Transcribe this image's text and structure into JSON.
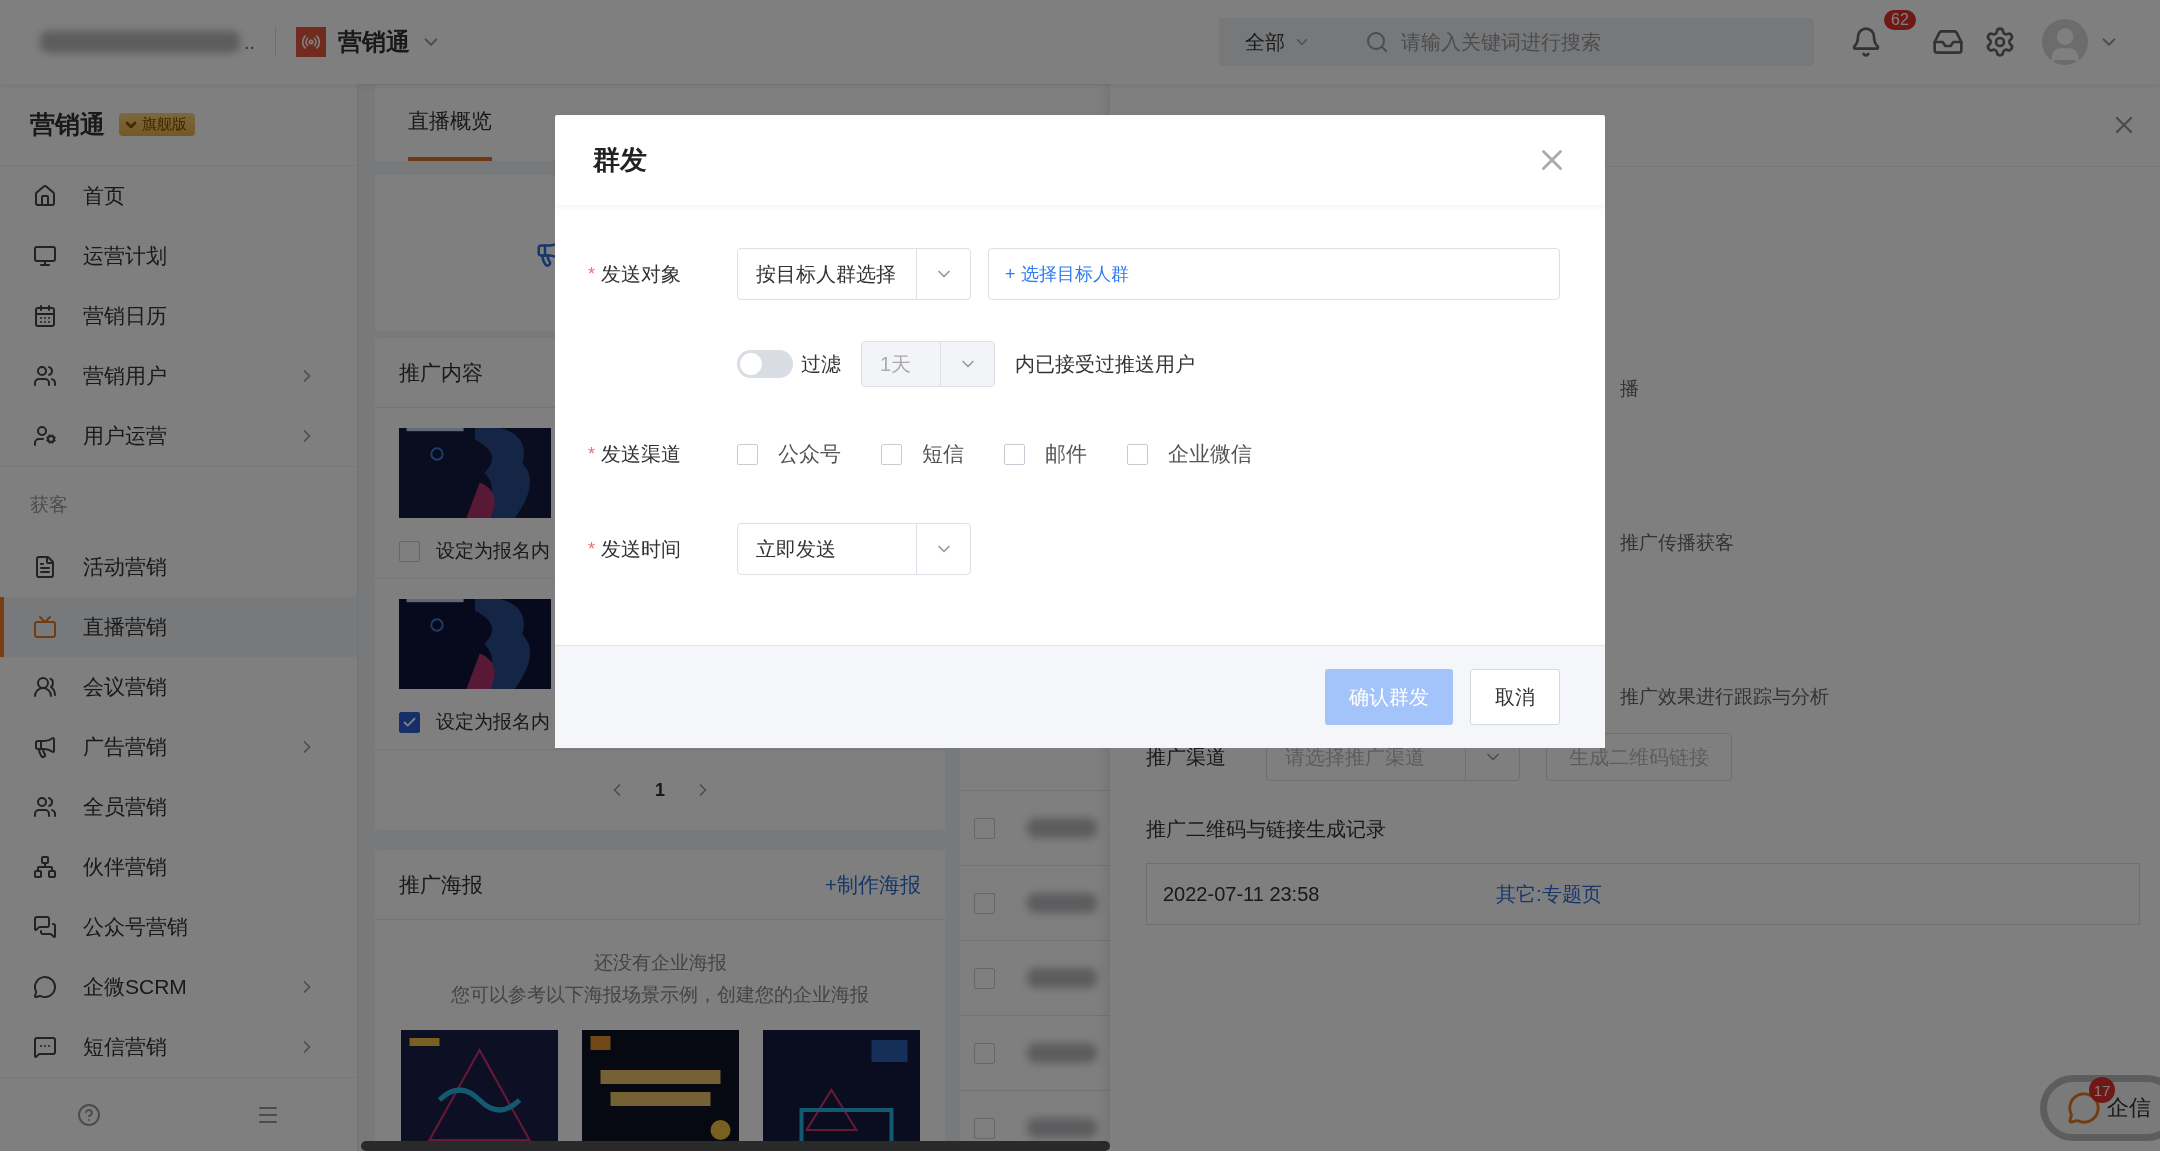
{
  "topbar": {
    "org_name_tail": "..",
    "app_name": "营销通",
    "search_scope": "全部",
    "search_placeholder": "请输入关键词进行搜索",
    "notification_count": "62"
  },
  "sidebar": {
    "brand": "营销通",
    "edition": "旗舰版",
    "groups": [
      {
        "items": [
          {
            "label": "首页",
            "selected": false,
            "expandable": false
          },
          {
            "label": "运营计划",
            "selected": false,
            "expandable": false
          },
          {
            "label": "营销日历",
            "selected": false,
            "expandable": false
          },
          {
            "label": "营销用户",
            "selected": false,
            "expandable": true
          },
          {
            "label": "用户运营",
            "selected": false,
            "expandable": true
          }
        ]
      },
      {
        "title": "获客",
        "items": [
          {
            "label": "活动营销",
            "selected": false,
            "expandable": false
          },
          {
            "label": "直播营销",
            "selected": true,
            "expandable": false
          },
          {
            "label": "会议营销",
            "selected": false,
            "expandable": false
          },
          {
            "label": "广告营销",
            "selected": false,
            "expandable": true
          },
          {
            "label": "全员营销",
            "selected": false,
            "expandable": false
          },
          {
            "label": "伙伴营销",
            "selected": false,
            "expandable": false
          },
          {
            "label": "公众号营销",
            "selected": false,
            "expandable": false
          },
          {
            "label": "企微SCRM",
            "selected": false,
            "expandable": true
          },
          {
            "label": "短信营销",
            "selected": false,
            "expandable": true
          }
        ]
      }
    ]
  },
  "main": {
    "tabs": [
      {
        "label": "直播概览",
        "selected": true
      }
    ],
    "content_card": {
      "title": "推广内容",
      "items": [
        {
          "label": "设定为报名内",
          "checked": false
        },
        {
          "label": "设定为报名内",
          "checked": true
        }
      ],
      "page": "1"
    },
    "poster_card": {
      "title": "推广海报",
      "action": "+制作海报",
      "empty_title": "还没有企业海报",
      "empty_hint": "您可以参考以下海报场景示例，创建您的企业海报"
    },
    "list_rows": [
      {
        "checked": false
      },
      {
        "checked": false
      },
      {
        "checked": false
      },
      {
        "checked": false
      },
      {
        "checked": false
      }
    ]
  },
  "drawer": {
    "fragments": [
      "播",
      "推广传播获客",
      "推广效果进行跟踪与分析"
    ],
    "channel_label": "推广渠道",
    "channel_placeholder": "请选择推广渠道",
    "generate_button": "生成二维码链接",
    "records_title": "推广二维码与链接生成记录",
    "records": [
      {
        "time": "2022-07-11 23:58",
        "type": "其它:专题页"
      }
    ]
  },
  "dialog": {
    "title": "群发",
    "fields": [
      {
        "kind": "target",
        "required_mark": "*",
        "label": "发送对象",
        "select": "按目标人群选择",
        "action": "+ 选择目标人群"
      },
      {
        "kind": "filter",
        "switch_on": false,
        "switch_label": "过滤",
        "select": "1天",
        "select_disabled": true,
        "suffix": "内已接受过推送用户"
      },
      {
        "kind": "checkboxes",
        "required_mark": "*",
        "label": "发送渠道",
        "options": [
          {
            "label": "公众号",
            "checked": false
          },
          {
            "label": "短信",
            "checked": false
          },
          {
            "label": "邮件",
            "checked": false
          },
          {
            "label": "企业微信",
            "checked": false
          }
        ]
      },
      {
        "kind": "select",
        "required_mark": "*",
        "label": "发送时间",
        "select": "立即发送"
      }
    ],
    "buttons": [
      {
        "label": "确认群发",
        "kind": "primary",
        "disabled": true
      },
      {
        "label": "取消",
        "kind": "default",
        "disabled": false
      }
    ]
  },
  "chat_widget": {
    "label": "企信",
    "badge": "17"
  }
}
